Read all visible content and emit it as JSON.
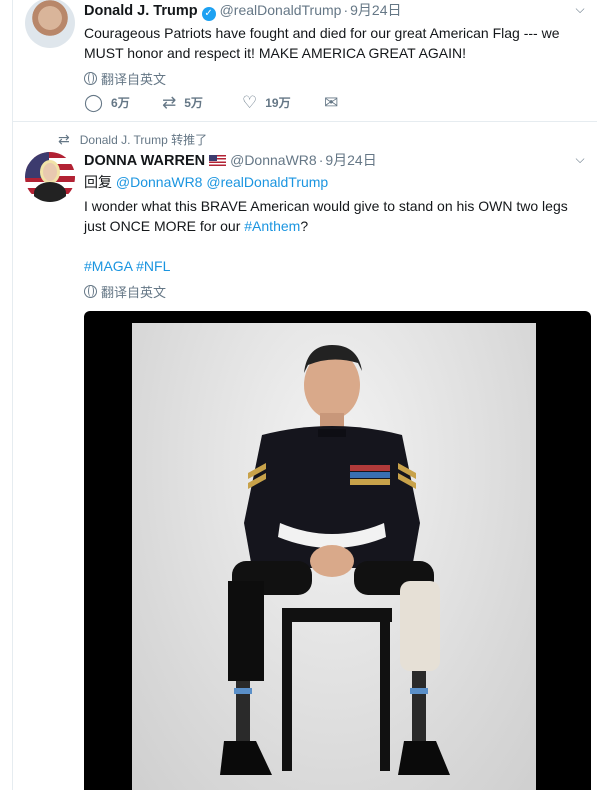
{
  "tweet1": {
    "author_name": "Donald J. Trump",
    "handle": "@realDonaldTrump",
    "separator": "·",
    "time": "9月24日",
    "text": "Courageous Patriots have fought and died for our great American Flag --- we MUST honor and respect it!  MAKE AMERICA GREAT AGAIN!",
    "translate_label": "翻译自英文",
    "replies": "6万",
    "retweets": "5万",
    "likes": "19万"
  },
  "tweet2": {
    "retweet_context": "Donald J. Trump 转推了",
    "author_name": "DONNA WARREN",
    "handle": "@DonnaWR8",
    "separator": "·",
    "time": "9月24日",
    "reply_prefix": "回复",
    "reply_to_1": "@DonnaWR8",
    "reply_to_2": "@realDonaldTrump",
    "text_before_link": "I wonder what this BRAVE American would give to stand on his OWN two legs just ONCE MORE for our ",
    "hashtag_anthem": "#Anthem",
    "text_after_link": "?",
    "hashtag_maga": "#MAGA",
    "hashtag_nfl": "#NFL",
    "translate_label": "翻译自英文"
  },
  "colors": {
    "link": "#1b95e0",
    "secondary_text": "#657786",
    "verified_badge": "#1da1f2"
  }
}
